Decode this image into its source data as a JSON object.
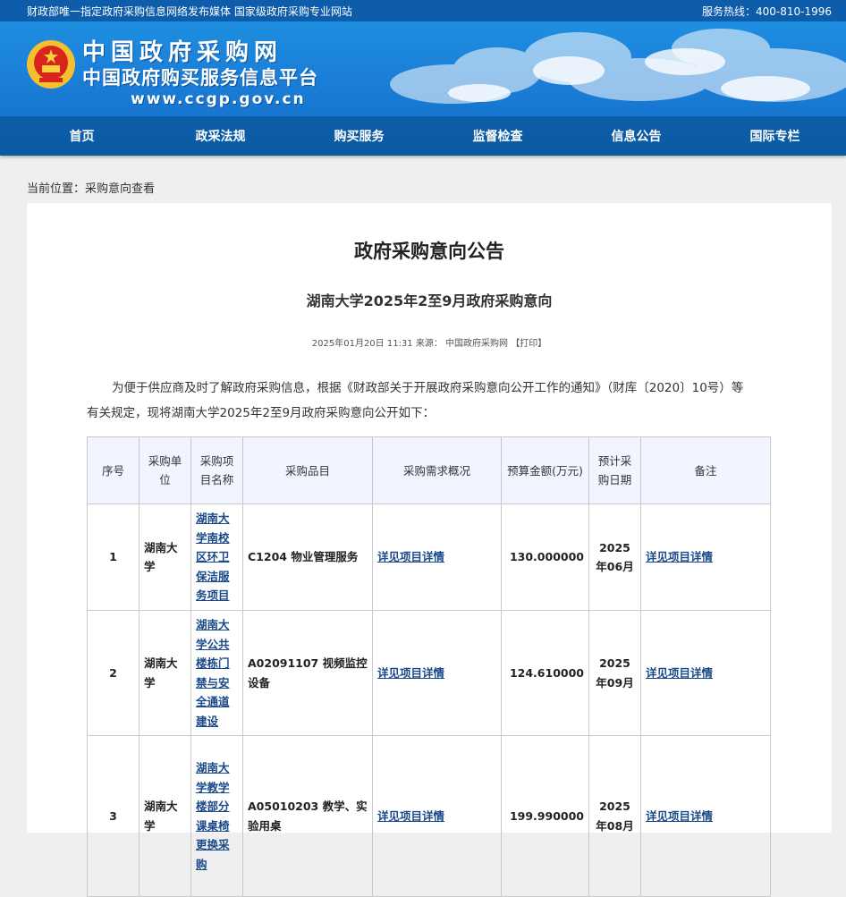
{
  "topbar": {
    "left_text": "财政部唯一指定政府采购信息网络发布媒体 国家级政府采购专业网站",
    "hotline": "服务热线：400-810-1996"
  },
  "logo": {
    "line1": "中国政府采购网",
    "line2": "中国政府购买服务信息平台",
    "url": "www.ccgp.gov.cn"
  },
  "nav": [
    "首页",
    "政采法规",
    "购买服务",
    "监督检查",
    "信息公告",
    "国际专栏"
  ],
  "breadcrumb": "当前位置：采购意向查看",
  "article": {
    "title": "政府采购意向公告",
    "subtitle": "湖南大学2025年2至9月政府采购意向",
    "date": "2025年01月20日 11:31",
    "source_label": "来源：",
    "source": "中国政府采购网",
    "print": "【打印】",
    "intro": "为便于供应商及时了解政府采购信息，根据《财政部关于开展政府采购意向公开工作的通知》（财库〔2020〕10号）等有关规定，现将湖南大学2025年2至9月政府采购意向公开如下："
  },
  "table": {
    "headers": [
      "序号",
      "采购单位",
      "采购项目名称",
      "采购品目",
      "采购需求概况",
      "预算金额(万元)",
      "预计采购日期",
      "备注"
    ],
    "rows": [
      {
        "idx": "1",
        "unit": "湖南大学",
        "name": "湖南大学南校区环卫保洁服务项目",
        "category": "C1204 物业管理服务",
        "demand": "详见项目详情",
        "budget": "130.000000",
        "date": "2025年06月",
        "remark": "详见项目详情"
      },
      {
        "idx": "2",
        "unit": "湖南大学",
        "name": "湖南大学公共楼栋门禁与安全通道建设",
        "category": "A02091107 视频监控设备",
        "demand": "详见项目详情",
        "budget": "124.610000",
        "date": "2025年09月",
        "remark": "详见项目详情"
      },
      {
        "idx": "3",
        "unit": "湖南大学",
        "name": "湖南大学教学楼部分课桌椅更换采购",
        "category": "A05010203 教学、实验用桌",
        "demand": "详见项目详情",
        "budget": "199.990000",
        "date": "2025年08月",
        "remark": "详见项目详情"
      }
    ]
  },
  "colors": {
    "topbar": "#0d5dab",
    "nav": "#0c5ea8",
    "link": "#1a4a8a",
    "table_header_bg": "#f2f4ff"
  }
}
